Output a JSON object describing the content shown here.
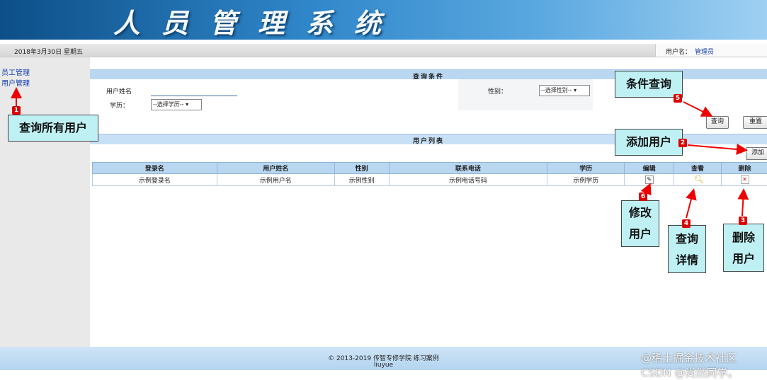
{
  "header": {
    "title": "人员管理系统"
  },
  "topbar": {
    "date": "2018年3月30日 星期五",
    "user_label": "用户名：",
    "user_name": "管理员"
  },
  "sidebar": {
    "items": [
      {
        "label": "员工管理"
      },
      {
        "label": "用户管理"
      }
    ]
  },
  "query": {
    "section_title": "查询条件",
    "name_label": "用户姓名",
    "gender_label": "性别：",
    "gender_select": "--选择性别--",
    "edu_label": "学历：",
    "edu_select": "--选择学历--",
    "search_button": "查询",
    "reset_button": "重置"
  },
  "list": {
    "section_title": "用户列表",
    "add_button": "添加",
    "columns": [
      "登录名",
      "用户姓名",
      "性别",
      "联系电话",
      "学历",
      "编辑",
      "查看",
      "删除"
    ],
    "rows": [
      {
        "login": "示例登录名",
        "name": "示例用户名",
        "gender": "示例性别",
        "phone": "示例电话号码",
        "edu": "示例学历"
      }
    ]
  },
  "footer": {
    "line1": "© 2013-2019 传智专修学院 练习案例",
    "line2": "liuyue"
  },
  "annotations": {
    "a1": {
      "badge": "1",
      "text": "查询所有用户"
    },
    "a2": {
      "badge": "2",
      "text": "添加用户"
    },
    "a3": {
      "badge": "3",
      "text": "删除用户"
    },
    "a4": {
      "badge": "4",
      "text": "查询详情"
    },
    "a5": {
      "badge": "5",
      "text": "条件查询"
    },
    "a6": {
      "badge": "6",
      "text": "修改用户"
    }
  },
  "watermark": "@稀土掘金技术社区 CSDN @尚然同学。",
  "colors": {
    "banner": "#2f86c9",
    "section": "#b9d7f1",
    "callout": "#bff1f4",
    "badge": "#dd0000",
    "link": "#1a3fb0"
  },
  "icons": {
    "edit": "pencil-icon",
    "view": "magnifier-icon",
    "delete": "close-icon"
  }
}
